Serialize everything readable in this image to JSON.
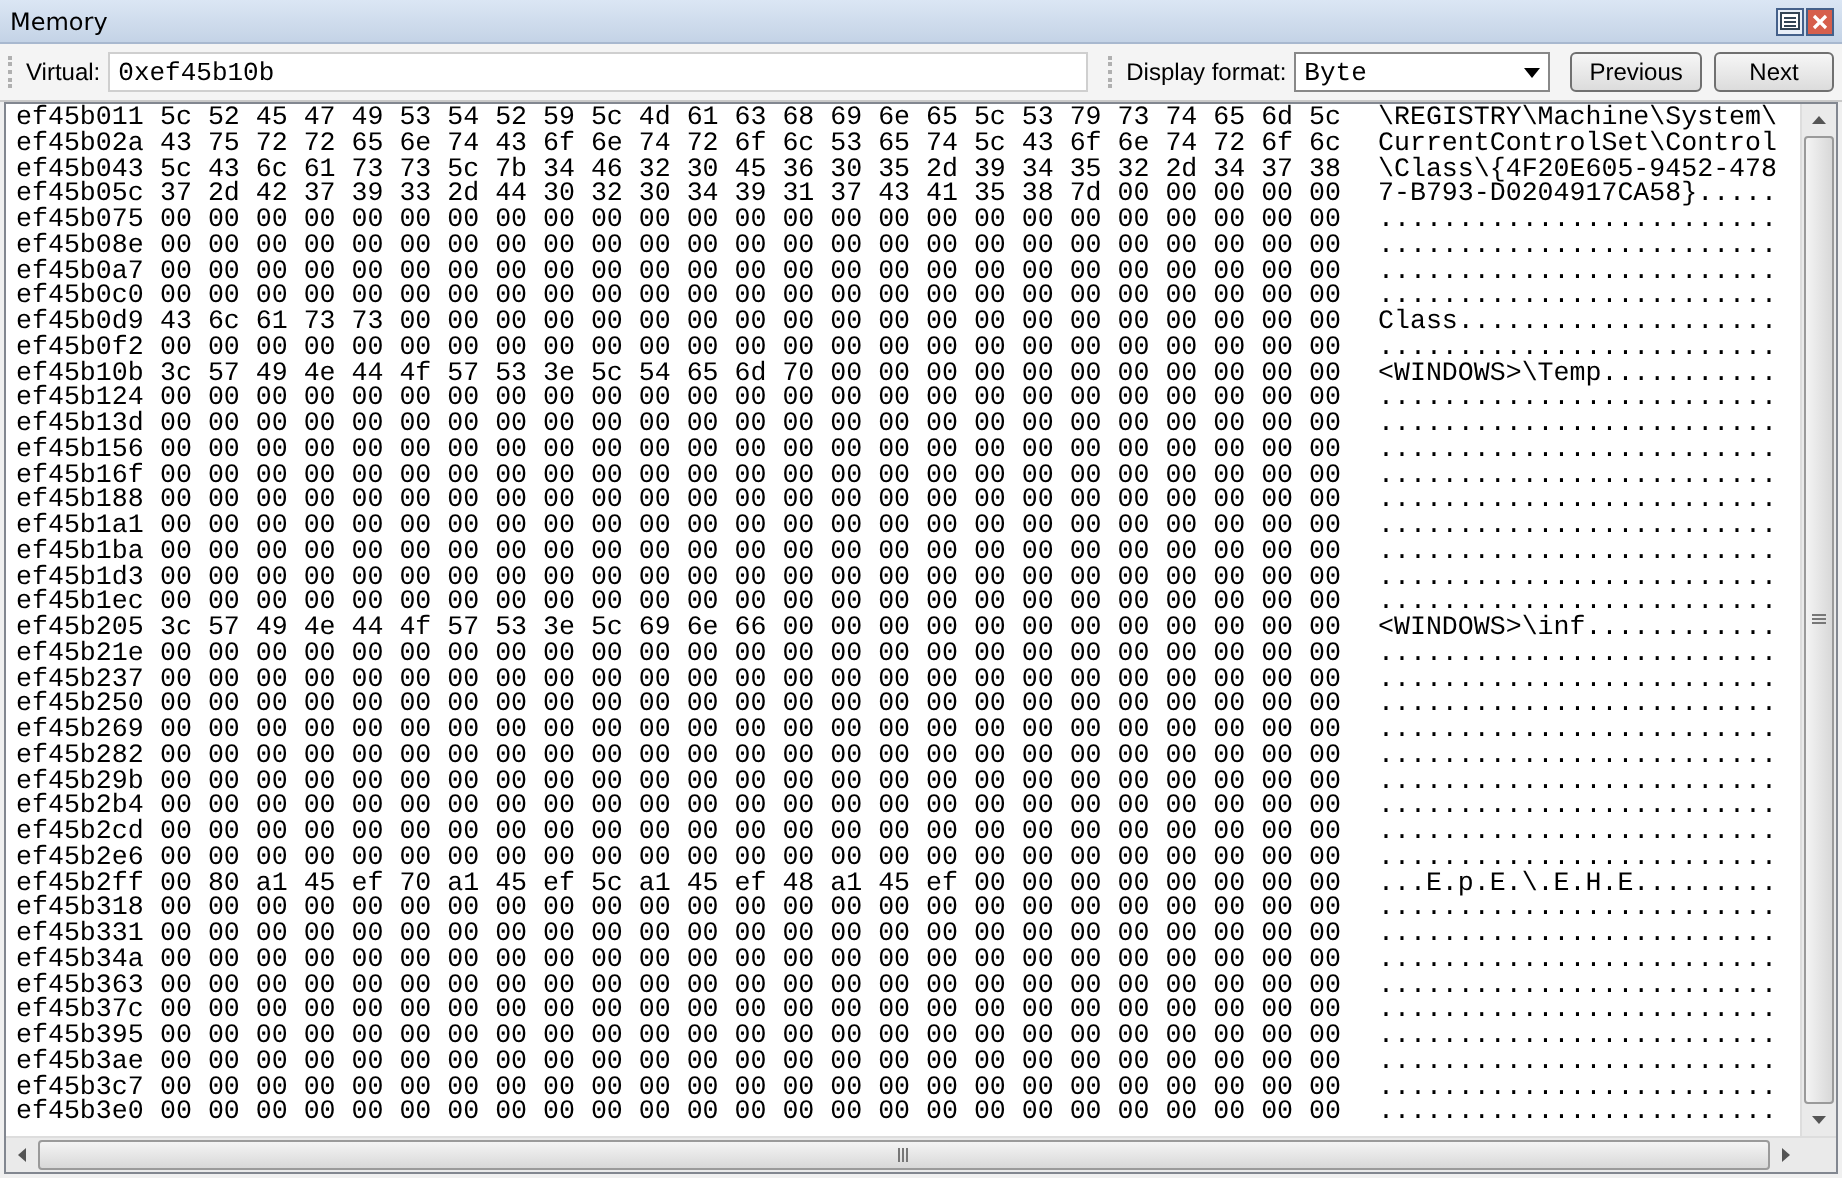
{
  "window": {
    "title": "Memory"
  },
  "toolbar": {
    "address_label": "Virtual:",
    "address": "0xef45b10b",
    "format_label": "Display format:",
    "format": "Byte",
    "buttons": [
      "Previous",
      "Next"
    ]
  },
  "rows": [
    {
      "address": "ef45b011",
      "bytes": "5c 52 45 47 49 53 54 52 59 5c 4d 61 63 68 69 6e 65 5c 53 79 73 74 65 6d 5c",
      "ascii": "\\REGISTRY\\Machine\\System\\"
    },
    {
      "address": "ef45b02a",
      "bytes": "43 75 72 72 65 6e 74 43 6f 6e 74 72 6f 6c 53 65 74 5c 43 6f 6e 74 72 6f 6c",
      "ascii": "CurrentControlSet\\Control"
    },
    {
      "address": "ef45b043",
      "bytes": "5c 43 6c 61 73 73 5c 7b 34 46 32 30 45 36 30 35 2d 39 34 35 32 2d 34 37 38",
      "ascii": "\\Class\\{4F20E605-9452-478"
    },
    {
      "address": "ef45b05c",
      "bytes": "37 2d 42 37 39 33 2d 44 30 32 30 34 39 31 37 43 41 35 38 7d 00 00 00 00 00",
      "ascii": "7-B793-D0204917CA58}....."
    },
    {
      "address": "ef45b075",
      "bytes": "00 00 00 00 00 00 00 00 00 00 00 00 00 00 00 00 00 00 00 00 00 00 00 00 00",
      "ascii": "........................."
    },
    {
      "address": "ef45b08e",
      "bytes": "00 00 00 00 00 00 00 00 00 00 00 00 00 00 00 00 00 00 00 00 00 00 00 00 00",
      "ascii": "........................."
    },
    {
      "address": "ef45b0a7",
      "bytes": "00 00 00 00 00 00 00 00 00 00 00 00 00 00 00 00 00 00 00 00 00 00 00 00 00",
      "ascii": "........................."
    },
    {
      "address": "ef45b0c0",
      "bytes": "00 00 00 00 00 00 00 00 00 00 00 00 00 00 00 00 00 00 00 00 00 00 00 00 00",
      "ascii": "........................."
    },
    {
      "address": "ef45b0d9",
      "bytes": "43 6c 61 73 73 00 00 00 00 00 00 00 00 00 00 00 00 00 00 00 00 00 00 00 00",
      "ascii": "Class...................."
    },
    {
      "address": "ef45b0f2",
      "bytes": "00 00 00 00 00 00 00 00 00 00 00 00 00 00 00 00 00 00 00 00 00 00 00 00 00",
      "ascii": "........................."
    },
    {
      "address": "ef45b10b",
      "bytes": "3c 57 49 4e 44 4f 57 53 3e 5c 54 65 6d 70 00 00 00 00 00 00 00 00 00 00 00",
      "ascii": "<WINDOWS>\\Temp..........."
    },
    {
      "address": "ef45b124",
      "bytes": "00 00 00 00 00 00 00 00 00 00 00 00 00 00 00 00 00 00 00 00 00 00 00 00 00",
      "ascii": "........................."
    },
    {
      "address": "ef45b13d",
      "bytes": "00 00 00 00 00 00 00 00 00 00 00 00 00 00 00 00 00 00 00 00 00 00 00 00 00",
      "ascii": "........................."
    },
    {
      "address": "ef45b156",
      "bytes": "00 00 00 00 00 00 00 00 00 00 00 00 00 00 00 00 00 00 00 00 00 00 00 00 00",
      "ascii": "........................."
    },
    {
      "address": "ef45b16f",
      "bytes": "00 00 00 00 00 00 00 00 00 00 00 00 00 00 00 00 00 00 00 00 00 00 00 00 00",
      "ascii": "........................."
    },
    {
      "address": "ef45b188",
      "bytes": "00 00 00 00 00 00 00 00 00 00 00 00 00 00 00 00 00 00 00 00 00 00 00 00 00",
      "ascii": "........................."
    },
    {
      "address": "ef45b1a1",
      "bytes": "00 00 00 00 00 00 00 00 00 00 00 00 00 00 00 00 00 00 00 00 00 00 00 00 00",
      "ascii": "........................."
    },
    {
      "address": "ef45b1ba",
      "bytes": "00 00 00 00 00 00 00 00 00 00 00 00 00 00 00 00 00 00 00 00 00 00 00 00 00",
      "ascii": "........................."
    },
    {
      "address": "ef45b1d3",
      "bytes": "00 00 00 00 00 00 00 00 00 00 00 00 00 00 00 00 00 00 00 00 00 00 00 00 00",
      "ascii": "........................."
    },
    {
      "address": "ef45b1ec",
      "bytes": "00 00 00 00 00 00 00 00 00 00 00 00 00 00 00 00 00 00 00 00 00 00 00 00 00",
      "ascii": "........................."
    },
    {
      "address": "ef45b205",
      "bytes": "3c 57 49 4e 44 4f 57 53 3e 5c 69 6e 66 00 00 00 00 00 00 00 00 00 00 00 00",
      "ascii": "<WINDOWS>\\inf............"
    },
    {
      "address": "ef45b21e",
      "bytes": "00 00 00 00 00 00 00 00 00 00 00 00 00 00 00 00 00 00 00 00 00 00 00 00 00",
      "ascii": "........................."
    },
    {
      "address": "ef45b237",
      "bytes": "00 00 00 00 00 00 00 00 00 00 00 00 00 00 00 00 00 00 00 00 00 00 00 00 00",
      "ascii": "........................."
    },
    {
      "address": "ef45b250",
      "bytes": "00 00 00 00 00 00 00 00 00 00 00 00 00 00 00 00 00 00 00 00 00 00 00 00 00",
      "ascii": "........................."
    },
    {
      "address": "ef45b269",
      "bytes": "00 00 00 00 00 00 00 00 00 00 00 00 00 00 00 00 00 00 00 00 00 00 00 00 00",
      "ascii": "........................."
    },
    {
      "address": "ef45b282",
      "bytes": "00 00 00 00 00 00 00 00 00 00 00 00 00 00 00 00 00 00 00 00 00 00 00 00 00",
      "ascii": "........................."
    },
    {
      "address": "ef45b29b",
      "bytes": "00 00 00 00 00 00 00 00 00 00 00 00 00 00 00 00 00 00 00 00 00 00 00 00 00",
      "ascii": "........................."
    },
    {
      "address": "ef45b2b4",
      "bytes": "00 00 00 00 00 00 00 00 00 00 00 00 00 00 00 00 00 00 00 00 00 00 00 00 00",
      "ascii": "........................."
    },
    {
      "address": "ef45b2cd",
      "bytes": "00 00 00 00 00 00 00 00 00 00 00 00 00 00 00 00 00 00 00 00 00 00 00 00 00",
      "ascii": "........................."
    },
    {
      "address": "ef45b2e6",
      "bytes": "00 00 00 00 00 00 00 00 00 00 00 00 00 00 00 00 00 00 00 00 00 00 00 00 00",
      "ascii": "........................."
    },
    {
      "address": "ef45b2ff",
      "bytes": "00 80 a1 45 ef 70 a1 45 ef 5c a1 45 ef 48 a1 45 ef 00 00 00 00 00 00 00 00",
      "ascii": "...E.p.E.\\.E.H.E........."
    },
    {
      "address": "ef45b318",
      "bytes": "00 00 00 00 00 00 00 00 00 00 00 00 00 00 00 00 00 00 00 00 00 00 00 00 00",
      "ascii": "........................."
    },
    {
      "address": "ef45b331",
      "bytes": "00 00 00 00 00 00 00 00 00 00 00 00 00 00 00 00 00 00 00 00 00 00 00 00 00",
      "ascii": "........................."
    },
    {
      "address": "ef45b34a",
      "bytes": "00 00 00 00 00 00 00 00 00 00 00 00 00 00 00 00 00 00 00 00 00 00 00 00 00",
      "ascii": "........................."
    },
    {
      "address": "ef45b363",
      "bytes": "00 00 00 00 00 00 00 00 00 00 00 00 00 00 00 00 00 00 00 00 00 00 00 00 00",
      "ascii": "........................."
    },
    {
      "address": "ef45b37c",
      "bytes": "00 00 00 00 00 00 00 00 00 00 00 00 00 00 00 00 00 00 00 00 00 00 00 00 00",
      "ascii": "........................."
    },
    {
      "address": "ef45b395",
      "bytes": "00 00 00 00 00 00 00 00 00 00 00 00 00 00 00 00 00 00 00 00 00 00 00 00 00",
      "ascii": "........................."
    },
    {
      "address": "ef45b3ae",
      "bytes": "00 00 00 00 00 00 00 00 00 00 00 00 00 00 00 00 00 00 00 00 00 00 00 00 00",
      "ascii": "........................."
    },
    {
      "address": "ef45b3c7",
      "bytes": "00 00 00 00 00 00 00 00 00 00 00 00 00 00 00 00 00 00 00 00 00 00 00 00 00",
      "ascii": "........................."
    },
    {
      "address": "ef45b3e0",
      "bytes": "00 00 00 00 00 00 00 00 00 00 00 00 00 00 00 00 00 00 00 00 00 00 00 00 00",
      "ascii": "........................."
    }
  ]
}
